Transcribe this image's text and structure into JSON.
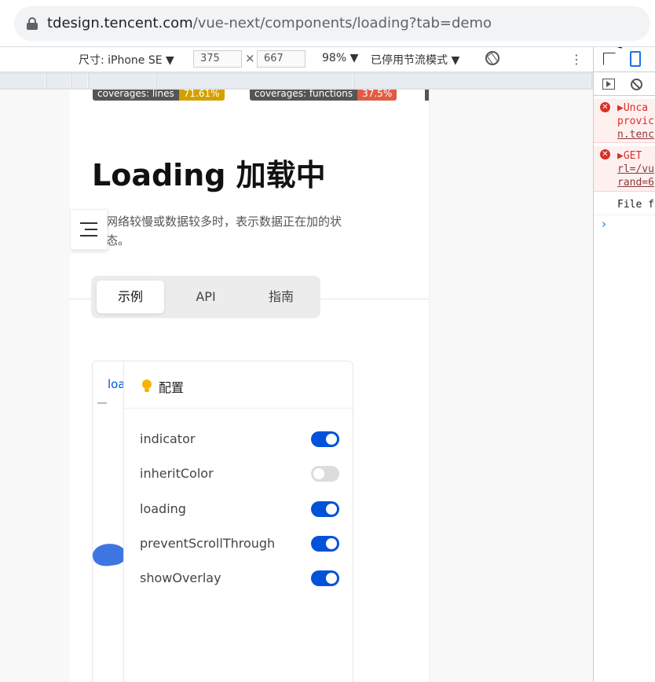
{
  "browser": {
    "url_host": "tdesign.tencent.com",
    "url_path": "/vue-next/components/loading?tab=demo"
  },
  "device_toolbar": {
    "device_label": "尺寸: iPhone SE ▼",
    "width": "375",
    "times": "×",
    "height": "667",
    "zoom": "98% ▼",
    "throttle": "已停用节流模式 ▼",
    "more": "⋮"
  },
  "page": {
    "badges": [
      {
        "label": "coverages: lines",
        "value": "71.61%",
        "color": "#d4a000"
      },
      {
        "label": "coverages: functions",
        "value": "37.5%",
        "color": "#e05d44"
      }
    ],
    "title": "Loading 加载中",
    "description": "网络较慢或数据较多时，表示数据正在加的状态。",
    "tabs": [
      "示例",
      "API",
      "指南"
    ],
    "active_tab": "示例",
    "demo_left_text": "loa",
    "config_title": "配置",
    "config": [
      {
        "label": "indicator",
        "on": true
      },
      {
        "label": "inheritColor",
        "on": false
      },
      {
        "label": "loading",
        "on": true
      },
      {
        "label": "preventScrollThrough",
        "on": true
      },
      {
        "label": "showOverlay",
        "on": true
      }
    ]
  },
  "devtools": {
    "errors": [
      {
        "lines": [
          "▶Unca",
          "provic",
          "n.tenc"
        ]
      },
      {
        "lines": [
          "▶GET ",
          "rl=/vu",
          "rand=6"
        ]
      }
    ],
    "info": "File f",
    "prompt": "›"
  },
  "colors": {
    "accent": "#0052d9",
    "switch_off": "#dcdcdc",
    "error": "#d93025"
  }
}
